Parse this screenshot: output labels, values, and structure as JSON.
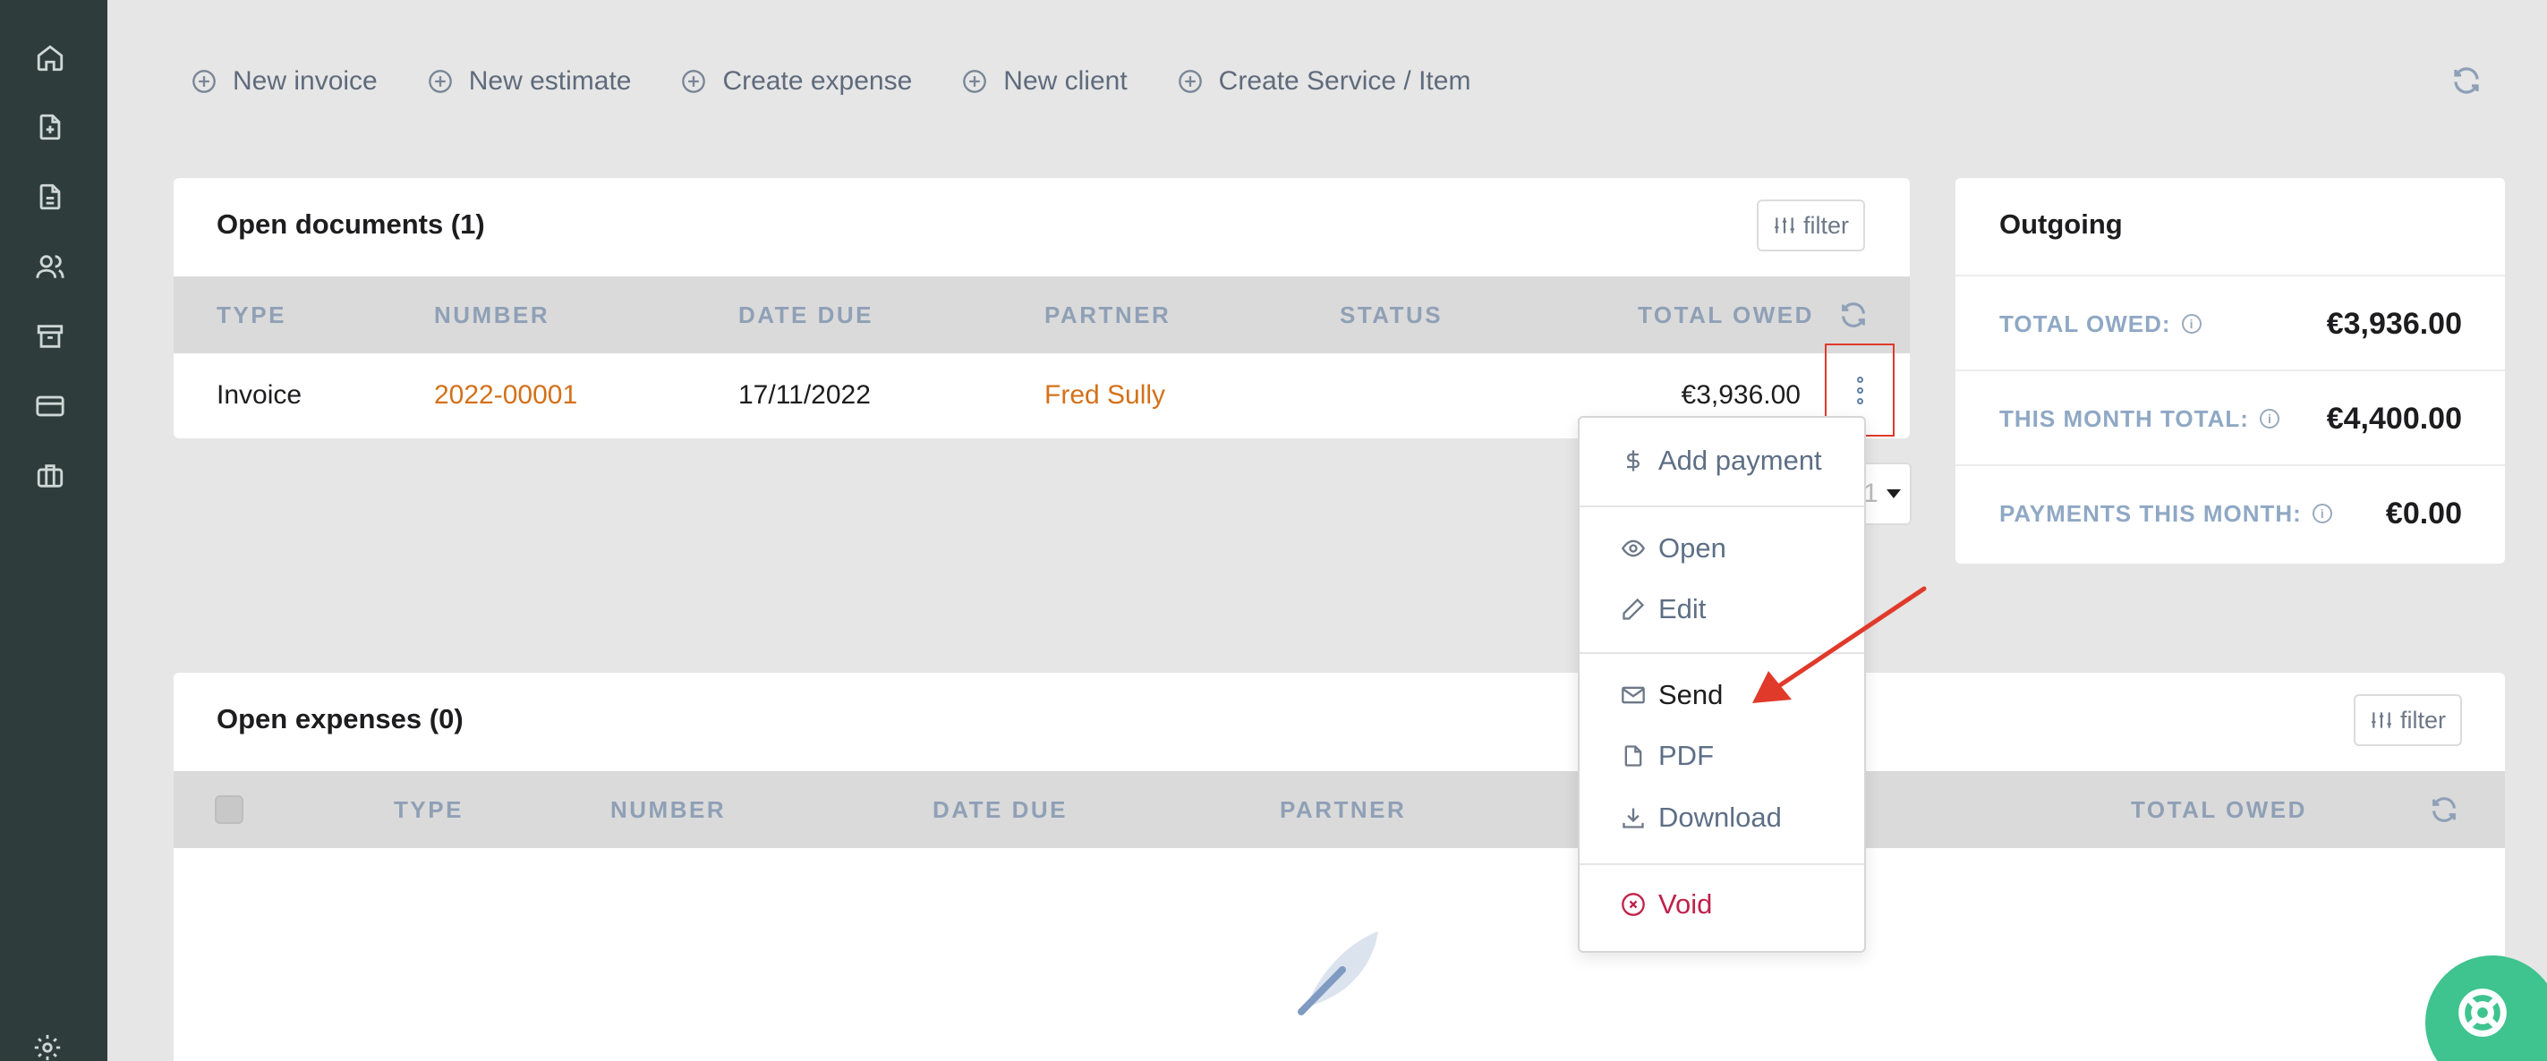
{
  "sidebar": {
    "icons": [
      "home-icon",
      "file-plus-icon",
      "file-icon",
      "users-icon",
      "archive-icon",
      "credit-card-icon",
      "briefcase-icon",
      "gear-icon"
    ]
  },
  "top_actions": [
    {
      "label": "New invoice",
      "icon": "plus-circle-icon"
    },
    {
      "label": "New estimate",
      "icon": "plus-circle-icon"
    },
    {
      "label": "Create expense",
      "icon": "plus-circle-icon"
    },
    {
      "label": "New client",
      "icon": "plus-circle-icon"
    },
    {
      "label": "Create Service / Item",
      "icon": "plus-circle-icon"
    }
  ],
  "open_documents": {
    "title": "Open documents (1)",
    "filter_label": "filter",
    "columns": [
      "TYPE",
      "NUMBER",
      "DATE DUE",
      "PARTNER",
      "STATUS",
      "TOTAL OWED"
    ],
    "rows": [
      {
        "type": "Invoice",
        "number": "2022-00001",
        "date_due": "17/11/2022",
        "partner": "Fred Sully",
        "status": "",
        "total_owed": "€3,936.00"
      }
    ],
    "pager_value": "1"
  },
  "row_menu": {
    "items": [
      {
        "label": "Add payment",
        "icon": "dollar-icon"
      },
      {
        "label": "Open",
        "icon": "eye-icon"
      },
      {
        "label": "Edit",
        "icon": "pencil-icon"
      },
      {
        "label": "Send",
        "icon": "mail-icon"
      },
      {
        "label": "PDF",
        "icon": "file-icon"
      },
      {
        "label": "Download",
        "icon": "download-icon"
      },
      {
        "label": "Void",
        "icon": "x-circle-icon"
      }
    ]
  },
  "outgoing": {
    "title": "Outgoing",
    "rows": [
      {
        "label": "TOTAL OWED:",
        "value": "€3,936.00"
      },
      {
        "label": "THIS MONTH TOTAL:",
        "value": "€4,400.00"
      },
      {
        "label": "PAYMENTS THIS MONTH:",
        "value": "€0.00"
      }
    ]
  },
  "open_expenses": {
    "title": "Open expenses (0)",
    "filter_label": "filter",
    "columns": [
      "TYPE",
      "NUMBER",
      "DATE DUE",
      "PARTNER",
      "TOTAL OWED"
    ]
  },
  "colors": {
    "sidebar": "#2e3d3b",
    "accent_link": "#d4711a",
    "void": "#c0224a",
    "help_fab": "#3fc38f",
    "annotation": "#e03a2b"
  }
}
